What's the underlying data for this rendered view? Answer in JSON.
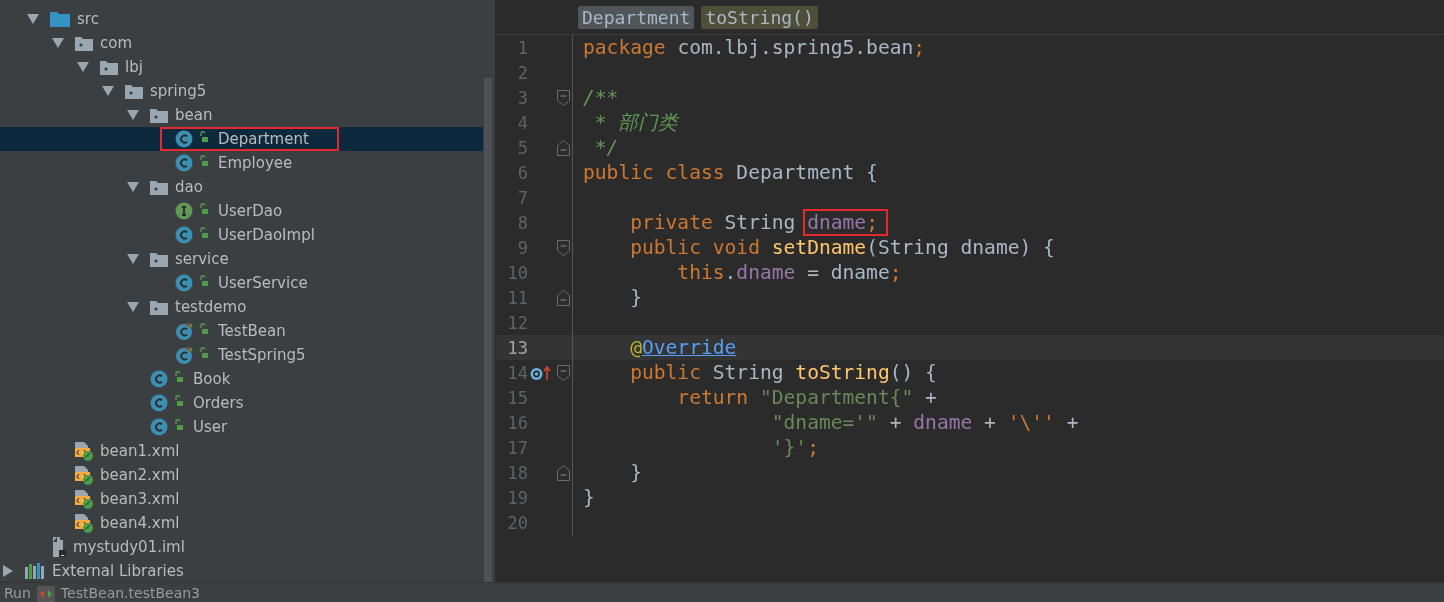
{
  "tree": {
    "module_items": [
      {
        "label": "src",
        "kind": "source-folder",
        "expanded": true,
        "selected": false,
        "highlighted": false,
        "children": [
          {
            "label": "com",
            "kind": "package",
            "expanded": true,
            "selected": false,
            "highlighted": false,
            "children": [
              {
                "label": "lbj",
                "kind": "package",
                "expanded": true,
                "selected": false,
                "highlighted": false,
                "children": [
                  {
                    "label": "spring5",
                    "kind": "package",
                    "expanded": true,
                    "selected": false,
                    "highlighted": false,
                    "children": [
                      {
                        "label": "bean",
                        "kind": "package",
                        "expanded": true,
                        "selected": false,
                        "highlighted": false,
                        "children": [
                          {
                            "label": "Department",
                            "kind": "class",
                            "selected": true,
                            "highlighted": true
                          },
                          {
                            "label": "Employee",
                            "kind": "class",
                            "selected": false,
                            "highlighted": false
                          }
                        ]
                      },
                      {
                        "label": "dao",
                        "kind": "package",
                        "expanded": true,
                        "selected": false,
                        "highlighted": false,
                        "children": [
                          {
                            "label": "UserDao",
                            "kind": "interface",
                            "selected": false,
                            "highlighted": false
                          },
                          {
                            "label": "UserDaoImpl",
                            "kind": "class",
                            "selected": false,
                            "highlighted": false
                          }
                        ]
                      },
                      {
                        "label": "service",
                        "kind": "package",
                        "expanded": true,
                        "selected": false,
                        "highlighted": false,
                        "children": [
                          {
                            "label": "UserService",
                            "kind": "class",
                            "selected": false,
                            "highlighted": false
                          }
                        ]
                      },
                      {
                        "label": "testdemo",
                        "kind": "package",
                        "expanded": true,
                        "selected": false,
                        "highlighted": false,
                        "children": [
                          {
                            "label": "TestBean",
                            "kind": "test-class",
                            "selected": false,
                            "highlighted": false
                          },
                          {
                            "label": "TestSpring5",
                            "kind": "test-class",
                            "selected": false,
                            "highlighted": false
                          }
                        ]
                      },
                      {
                        "label": "Book",
                        "kind": "class",
                        "selected": false,
                        "highlighted": false
                      },
                      {
                        "label": "Orders",
                        "kind": "class",
                        "selected": false,
                        "highlighted": false
                      },
                      {
                        "label": "User",
                        "kind": "class",
                        "selected": false,
                        "highlighted": false
                      }
                    ]
                  }
                ]
              }
            ]
          },
          {
            "label": "bean1.xml",
            "kind": "xml",
            "selected": false,
            "highlighted": false
          },
          {
            "label": "bean2.xml",
            "kind": "xml",
            "selected": false,
            "highlighted": false
          },
          {
            "label": "bean3.xml",
            "kind": "xml",
            "selected": false,
            "highlighted": false
          },
          {
            "label": "bean4.xml",
            "kind": "xml",
            "selected": false,
            "highlighted": false
          }
        ]
      },
      {
        "label": "mystudy01.iml",
        "kind": "iml",
        "selected": false,
        "highlighted": false
      }
    ],
    "root_items": [
      {
        "label": "External Libraries",
        "kind": "libraries",
        "expanded": false,
        "selected": false,
        "highlighted": false
      }
    ]
  },
  "editor": {
    "breadcrumbs": [
      {
        "label": "Department",
        "kind": "class"
      },
      {
        "label": "toString()",
        "kind": "method"
      }
    ],
    "lines": [
      {
        "number": "1",
        "current": false,
        "fold_start": false,
        "fold_end": false,
        "override": false,
        "tokens": [
          {
            "text": "package ",
            "kind": "keyword"
          },
          {
            "text": "com.lbj.spring5.bean",
            "kind": "plain"
          },
          {
            "text": ";",
            "kind": "keyword"
          }
        ]
      },
      {
        "number": "2",
        "current": false,
        "fold_start": false,
        "fold_end": false,
        "override": false
      },
      {
        "number": "3",
        "current": false,
        "fold_start": true,
        "fold_end": false,
        "override": false,
        "tokens": [
          {
            "text": "/**",
            "kind": "doc"
          }
        ]
      },
      {
        "number": "4",
        "current": false,
        "fold_start": false,
        "fold_end": false,
        "override": false,
        "tokens": [
          {
            "text": " * ",
            "kind": "doc"
          },
          {
            "text": "部门类",
            "kind": "doc"
          }
        ]
      },
      {
        "number": "5",
        "current": false,
        "fold_start": false,
        "fold_end": true,
        "override": false,
        "tokens": [
          {
            "text": " */",
            "kind": "doc"
          }
        ]
      },
      {
        "number": "6",
        "current": false,
        "fold_start": false,
        "fold_end": false,
        "override": false,
        "tokens": [
          {
            "text": "public class ",
            "kind": "keyword"
          },
          {
            "text": "Department {",
            "kind": "plain"
          }
        ]
      },
      {
        "number": "7",
        "current": false,
        "fold_start": false,
        "fold_end": false,
        "override": false
      },
      {
        "number": "8",
        "current": false,
        "fold_start": false,
        "fold_end": false,
        "override": false,
        "tokens": [
          {
            "text": "    private ",
            "kind": "keyword"
          },
          {
            "text": "String ",
            "kind": "plain"
          },
          {
            "text": "dname",
            "kind": "field",
            "highlighted": true
          },
          {
            "text": ";",
            "kind": "keyword",
            "highlighted": true
          }
        ]
      },
      {
        "number": "9",
        "current": false,
        "fold_start": true,
        "fold_end": false,
        "override": false,
        "tokens": [
          {
            "text": "    public void ",
            "kind": "keyword"
          },
          {
            "text": "setDname",
            "kind": "method"
          },
          {
            "text": "(String dname) {",
            "kind": "plain"
          }
        ]
      },
      {
        "number": "10",
        "current": false,
        "fold_start": false,
        "fold_end": false,
        "override": false,
        "tokens": [
          {
            "text": "        this",
            "kind": "keyword"
          },
          {
            "text": ".",
            "kind": "plain"
          },
          {
            "text": "dname",
            "kind": "field"
          },
          {
            "text": " = dname",
            "kind": "plain"
          },
          {
            "text": ";",
            "kind": "keyword"
          }
        ]
      },
      {
        "number": "11",
        "current": false,
        "fold_start": false,
        "fold_end": true,
        "override": false,
        "tokens": [
          {
            "text": "    }",
            "kind": "plain"
          }
        ]
      },
      {
        "number": "12",
        "current": false,
        "fold_start": false,
        "fold_end": false,
        "override": false
      },
      {
        "number": "13",
        "current": true,
        "fold_start": false,
        "fold_end": false,
        "override": false,
        "tokens": [
          {
            "text": "    @",
            "kind": "annotation"
          },
          {
            "text": "Override",
            "kind": "link"
          }
        ]
      },
      {
        "number": "14",
        "current": false,
        "fold_start": true,
        "fold_end": false,
        "override": true,
        "tokens": [
          {
            "text": "    public ",
            "kind": "keyword"
          },
          {
            "text": "String ",
            "kind": "plain"
          },
          {
            "text": "toString",
            "kind": "method"
          },
          {
            "text": "() {",
            "kind": "plain"
          }
        ]
      },
      {
        "number": "15",
        "current": false,
        "fold_start": false,
        "fold_end": false,
        "override": false,
        "tokens": [
          {
            "text": "        return ",
            "kind": "keyword"
          },
          {
            "text": "\"Department{\"",
            "kind": "string"
          },
          {
            "text": " +",
            "kind": "plain"
          }
        ]
      },
      {
        "number": "16",
        "current": false,
        "fold_start": false,
        "fold_end": false,
        "override": false,
        "tokens": [
          {
            "text": "                \"dname='\"",
            "kind": "string"
          },
          {
            "text": " + ",
            "kind": "plain"
          },
          {
            "text": "dname",
            "kind": "field"
          },
          {
            "text": " + ",
            "kind": "plain"
          },
          {
            "text": "'\\''",
            "kind": "char"
          },
          {
            "text": " +",
            "kind": "plain"
          }
        ]
      },
      {
        "number": "17",
        "current": false,
        "fold_start": false,
        "fold_end": false,
        "override": false,
        "tokens": [
          {
            "text": "                '}'",
            "kind": "string"
          },
          {
            "text": ";",
            "kind": "keyword"
          }
        ]
      },
      {
        "number": "18",
        "current": false,
        "fold_start": false,
        "fold_end": true,
        "override": false,
        "tokens": [
          {
            "text": "    }",
            "kind": "plain"
          }
        ]
      },
      {
        "number": "19",
        "current": false,
        "fold_start": false,
        "fold_end": false,
        "override": false,
        "tokens": [
          {
            "text": "}",
            "kind": "plain"
          }
        ]
      },
      {
        "number": "20",
        "current": false,
        "fold_start": false,
        "fold_end": false,
        "override": false
      }
    ]
  },
  "run_bar": {
    "label": "Run",
    "tab": "TestBean.testBean3"
  }
}
